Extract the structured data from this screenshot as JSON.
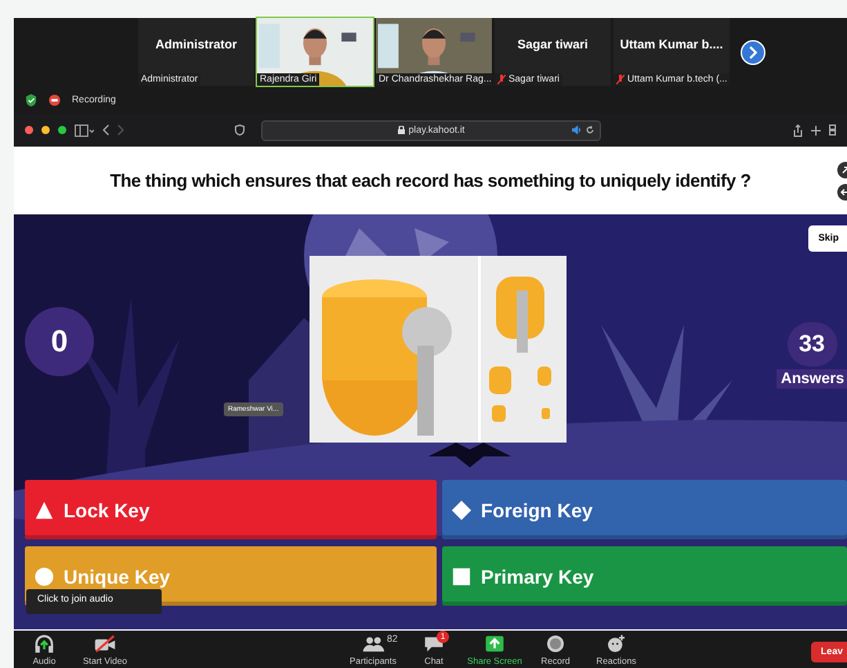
{
  "meeting_tiles": [
    {
      "kind": "name",
      "title": "Administrator",
      "label": "Administrator",
      "muted": false
    },
    {
      "kind": "video",
      "label": "Rajendra Giri",
      "muted": false,
      "speaking": true
    },
    {
      "kind": "video",
      "label": "Dr Chandrashekhar Rag...",
      "muted": false,
      "speaking": false
    },
    {
      "kind": "name",
      "title": "Sagar tiwari",
      "label": "Sagar tiwari",
      "muted": true
    },
    {
      "kind": "name",
      "title": "Uttam  Kumar b....",
      "label": "Uttam Kumar b.tech (...",
      "muted": true
    }
  ],
  "status": {
    "recording": "Recording"
  },
  "browser": {
    "url": "play.kahoot.it"
  },
  "question": "The thing which ensures that each record has something to uniquely identify ?",
  "stage": {
    "counter": "0",
    "answers_count": "33",
    "answers_label": "Answers",
    "skip": "Skip",
    "name_tag": "Rameshwar Vi..."
  },
  "answers": [
    {
      "kind": "triangle",
      "label": "Lock Key",
      "color": "#e8202e"
    },
    {
      "kind": "diamond",
      "label": "Foreign Key",
      "color": "#3263ad"
    },
    {
      "kind": "circle",
      "label": "Unique Key",
      "color": "#e09d28"
    },
    {
      "kind": "square",
      "label": "Primary Key",
      "color": "#1a9545"
    }
  ],
  "tooltip": "Click to join audio",
  "toolbar": [
    {
      "kind": "audio",
      "label": "Audio"
    },
    {
      "kind": "video",
      "label": "Start Video"
    },
    {
      "kind": "participants",
      "label": "Participants",
      "count": "82"
    },
    {
      "kind": "chat",
      "label": "Chat",
      "badge": "1"
    },
    {
      "kind": "share",
      "label": "Share Screen"
    },
    {
      "kind": "record",
      "label": "Record"
    },
    {
      "kind": "reactions",
      "label": "Reactions"
    }
  ],
  "leave": "Leav"
}
